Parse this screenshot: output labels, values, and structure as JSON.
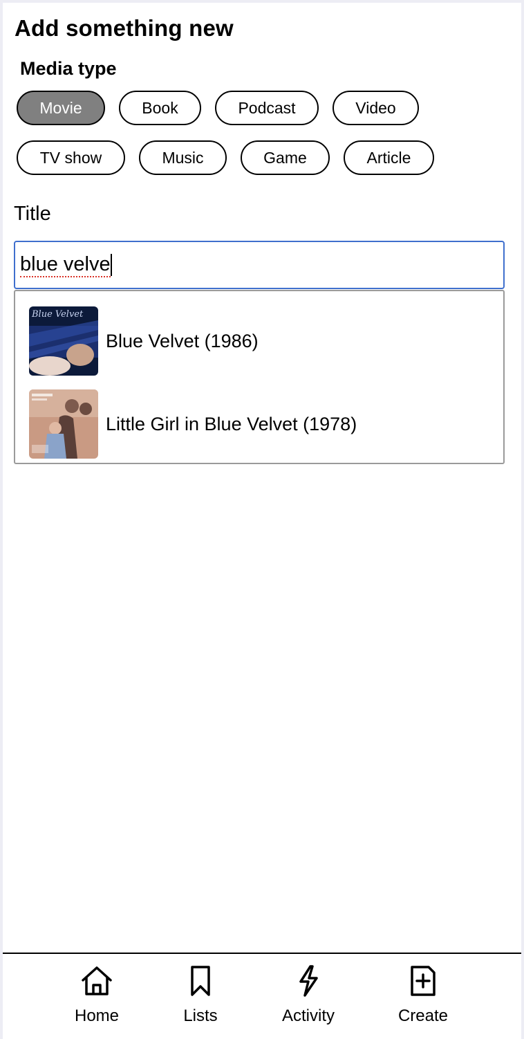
{
  "page": {
    "title": "Add something new",
    "media_type_label": "Media type"
  },
  "media_types": {
    "selected": "Movie",
    "items": [
      "Movie",
      "Book",
      "Podcast",
      "Video",
      "TV show",
      "Music",
      "Game",
      "Article"
    ]
  },
  "title_field": {
    "label": "Title",
    "value": "blue velve"
  },
  "results": [
    {
      "label": "Blue Velvet (1986)",
      "thumbnail": "blue-velvet-poster"
    },
    {
      "label": "Little Girl in Blue Velvet (1978)",
      "thumbnail": "little-girl-in-blue-velvet-poster"
    }
  ],
  "nav": {
    "home": {
      "label": "Home",
      "icon": "home-icon"
    },
    "lists": {
      "label": "Lists",
      "icon": "bookmark-icon"
    },
    "activity": {
      "label": "Activity",
      "icon": "lightning-icon"
    },
    "create": {
      "label": "Create",
      "icon": "add-document-icon"
    }
  },
  "colors": {
    "selected_chip": "#808080",
    "input_focus": "#3f6fcd",
    "spellcheck": "#d93025"
  }
}
